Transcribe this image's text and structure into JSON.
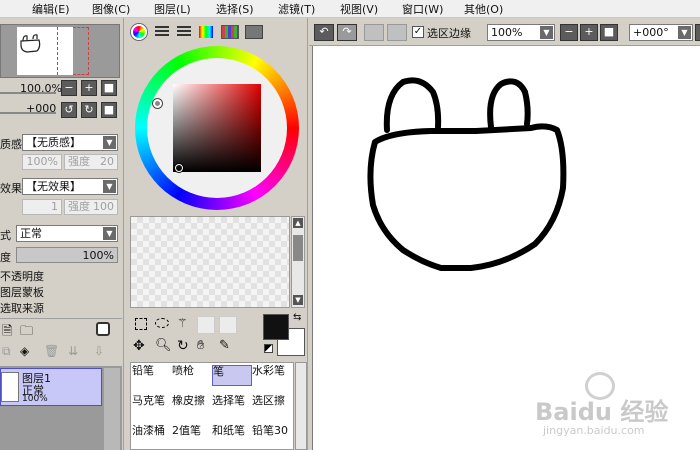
{
  "menubar": {
    "items": [
      "编辑(E)",
      "图像(C)",
      "图层(L)",
      "选择(S)",
      "滤镜(T)",
      "视图(V)",
      "窗口(W)",
      "其他(O)"
    ]
  },
  "left_panel": {
    "zoom_value": "100.0%",
    "rotation_value": "+000",
    "texture_label": "质感",
    "texture_value": "【无质感】",
    "texture_scale": "100%",
    "texture_strength_label": "强度",
    "texture_strength_value": "20",
    "effect_label": "效果",
    "effect_value": "【无效果】",
    "effect_width": "1",
    "effect_strength_label": "强度",
    "effect_strength_value": "100",
    "blend_mode_label": "式",
    "blend_mode_value": "正常",
    "opacity_label": "度",
    "opacity_value": "100%",
    "options": [
      "不透明度",
      "图层蒙板",
      "选取来源"
    ],
    "layer": {
      "name": "图层1",
      "mode": "正常",
      "opacity": "100%"
    }
  },
  "color_panel": {
    "primary_color": "#111111",
    "secondary_color": "#ffffff"
  },
  "tools": {
    "rows": [
      [
        "铅笔",
        "喷枪",
        "笔",
        "水彩笔"
      ],
      [
        "马克笔",
        "橡皮擦",
        "选择笔",
        "选区擦"
      ],
      [
        "油漆桶",
        "2值笔",
        "和纸笔",
        "铅笔30"
      ]
    ],
    "selected": "笔"
  },
  "canvas_toolbar": {
    "selection_edge_label": "选区边缘",
    "selection_edge_checked": true,
    "zoom": "100%",
    "rotation": "+000°"
  },
  "watermark": {
    "brand": "Baidu 经验",
    "url": "jingyan.baidu.com"
  }
}
